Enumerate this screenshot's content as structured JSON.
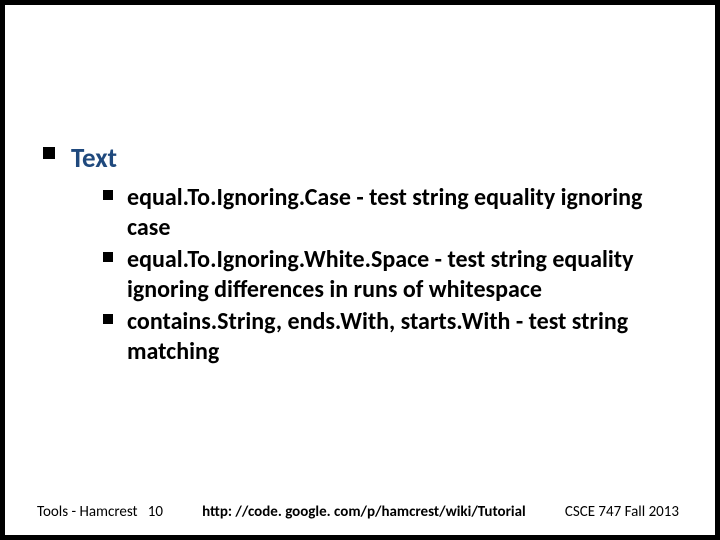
{
  "content": {
    "heading": "Text",
    "items": [
      "equal.To.Ignoring.Case - test string equality ignoring case",
      "equal.To.Ignoring.White.Space - test string equality ignoring differences in runs of whitespace",
      "contains.String, ends.With, starts.With - test string matching"
    ]
  },
  "footer": {
    "left_label": "Tools - Hamcrest",
    "page_number": "10",
    "url": "http: //code. google. com/p/hamcrest/wiki/Tutorial",
    "right": "CSCE 747 Fall 2013"
  }
}
